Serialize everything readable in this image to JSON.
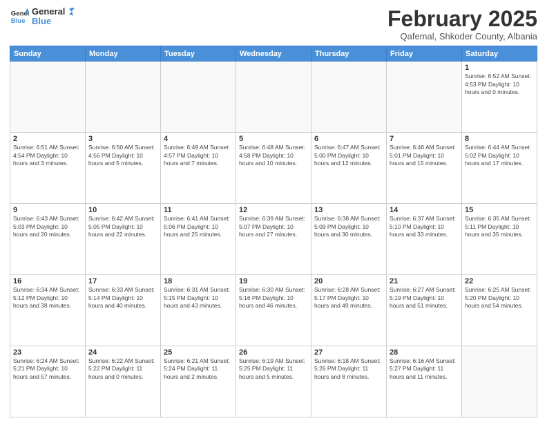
{
  "logo": {
    "line1": "General",
    "line2": "Blue"
  },
  "title": "February 2025",
  "subtitle": "Qafemal, Shkoder County, Albania",
  "weekdays": [
    "Sunday",
    "Monday",
    "Tuesday",
    "Wednesday",
    "Thursday",
    "Friday",
    "Saturday"
  ],
  "weeks": [
    [
      {
        "day": "",
        "info": ""
      },
      {
        "day": "",
        "info": ""
      },
      {
        "day": "",
        "info": ""
      },
      {
        "day": "",
        "info": ""
      },
      {
        "day": "",
        "info": ""
      },
      {
        "day": "",
        "info": ""
      },
      {
        "day": "1",
        "info": "Sunrise: 6:52 AM\nSunset: 4:53 PM\nDaylight: 10 hours\nand 0 minutes."
      }
    ],
    [
      {
        "day": "2",
        "info": "Sunrise: 6:51 AM\nSunset: 4:54 PM\nDaylight: 10 hours\nand 3 minutes."
      },
      {
        "day": "3",
        "info": "Sunrise: 6:50 AM\nSunset: 4:56 PM\nDaylight: 10 hours\nand 5 minutes."
      },
      {
        "day": "4",
        "info": "Sunrise: 6:49 AM\nSunset: 4:57 PM\nDaylight: 10 hours\nand 7 minutes."
      },
      {
        "day": "5",
        "info": "Sunrise: 6:48 AM\nSunset: 4:58 PM\nDaylight: 10 hours\nand 10 minutes."
      },
      {
        "day": "6",
        "info": "Sunrise: 6:47 AM\nSunset: 5:00 PM\nDaylight: 10 hours\nand 12 minutes."
      },
      {
        "day": "7",
        "info": "Sunrise: 6:46 AM\nSunset: 5:01 PM\nDaylight: 10 hours\nand 15 minutes."
      },
      {
        "day": "8",
        "info": "Sunrise: 6:44 AM\nSunset: 5:02 PM\nDaylight: 10 hours\nand 17 minutes."
      }
    ],
    [
      {
        "day": "9",
        "info": "Sunrise: 6:43 AM\nSunset: 5:03 PM\nDaylight: 10 hours\nand 20 minutes."
      },
      {
        "day": "10",
        "info": "Sunrise: 6:42 AM\nSunset: 5:05 PM\nDaylight: 10 hours\nand 22 minutes."
      },
      {
        "day": "11",
        "info": "Sunrise: 6:41 AM\nSunset: 5:06 PM\nDaylight: 10 hours\nand 25 minutes."
      },
      {
        "day": "12",
        "info": "Sunrise: 6:39 AM\nSunset: 5:07 PM\nDaylight: 10 hours\nand 27 minutes."
      },
      {
        "day": "13",
        "info": "Sunrise: 6:38 AM\nSunset: 5:09 PM\nDaylight: 10 hours\nand 30 minutes."
      },
      {
        "day": "14",
        "info": "Sunrise: 6:37 AM\nSunset: 5:10 PM\nDaylight: 10 hours\nand 33 minutes."
      },
      {
        "day": "15",
        "info": "Sunrise: 6:35 AM\nSunset: 5:11 PM\nDaylight: 10 hours\nand 35 minutes."
      }
    ],
    [
      {
        "day": "16",
        "info": "Sunrise: 6:34 AM\nSunset: 5:12 PM\nDaylight: 10 hours\nand 38 minutes."
      },
      {
        "day": "17",
        "info": "Sunrise: 6:33 AM\nSunset: 5:14 PM\nDaylight: 10 hours\nand 40 minutes."
      },
      {
        "day": "18",
        "info": "Sunrise: 6:31 AM\nSunset: 5:15 PM\nDaylight: 10 hours\nand 43 minutes."
      },
      {
        "day": "19",
        "info": "Sunrise: 6:30 AM\nSunset: 5:16 PM\nDaylight: 10 hours\nand 46 minutes."
      },
      {
        "day": "20",
        "info": "Sunrise: 6:28 AM\nSunset: 5:17 PM\nDaylight: 10 hours\nand 49 minutes."
      },
      {
        "day": "21",
        "info": "Sunrise: 6:27 AM\nSunset: 5:19 PM\nDaylight: 10 hours\nand 51 minutes."
      },
      {
        "day": "22",
        "info": "Sunrise: 6:25 AM\nSunset: 5:20 PM\nDaylight: 10 hours\nand 54 minutes."
      }
    ],
    [
      {
        "day": "23",
        "info": "Sunrise: 6:24 AM\nSunset: 5:21 PM\nDaylight: 10 hours\nand 57 minutes."
      },
      {
        "day": "24",
        "info": "Sunrise: 6:22 AM\nSunset: 5:22 PM\nDaylight: 11 hours\nand 0 minutes."
      },
      {
        "day": "25",
        "info": "Sunrise: 6:21 AM\nSunset: 5:24 PM\nDaylight: 11 hours\nand 2 minutes."
      },
      {
        "day": "26",
        "info": "Sunrise: 6:19 AM\nSunset: 5:25 PM\nDaylight: 11 hours\nand 5 minutes."
      },
      {
        "day": "27",
        "info": "Sunrise: 6:18 AM\nSunset: 5:26 PM\nDaylight: 11 hours\nand 8 minutes."
      },
      {
        "day": "28",
        "info": "Sunrise: 6:16 AM\nSunset: 5:27 PM\nDaylight: 11 hours\nand 11 minutes."
      },
      {
        "day": "",
        "info": ""
      }
    ]
  ]
}
